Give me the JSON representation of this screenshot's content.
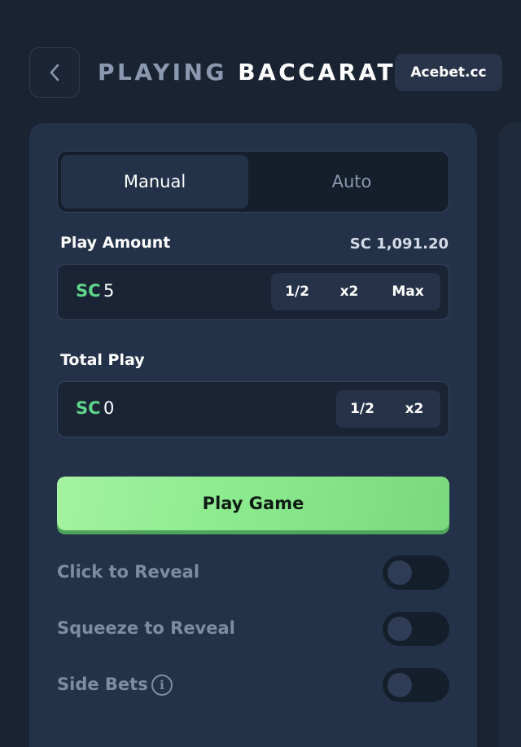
{
  "header": {
    "title_part1": "PLAYING",
    "title_part2": "BACCARAT",
    "brand": "Acebet.cc",
    "back_icon": "chevron-left-icon"
  },
  "tabs": [
    {
      "label": "Manual",
      "active": true
    },
    {
      "label": "Auto",
      "active": false
    }
  ],
  "play_amount": {
    "label": "Play Amount",
    "balance": "SC 1,091.20",
    "currency": "SC",
    "value": "5",
    "buttons": [
      "1/2",
      "x2",
      "Max"
    ]
  },
  "total_play": {
    "label": "Total Play",
    "currency": "SC",
    "value": "0",
    "buttons": [
      "1/2",
      "x2"
    ]
  },
  "play_button": "Play Game",
  "toggles": [
    {
      "label": "Click to Reveal",
      "on": false
    },
    {
      "label": "Squeeze to Reveal",
      "on": false
    },
    {
      "label": "Side Bets",
      "on": false,
      "info_icon": "info-icon"
    }
  ],
  "colors": {
    "background": "#1a2332",
    "panel": "#243249",
    "accent_green": "#8ceb8e",
    "currency_green": "#5fd68a"
  }
}
